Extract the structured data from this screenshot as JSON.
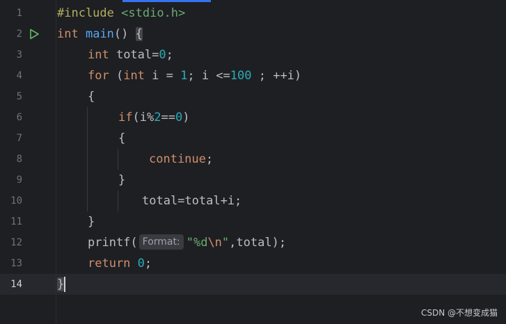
{
  "editor": {
    "line_numbers": [
      "1",
      "2",
      "3",
      "4",
      "5",
      "6",
      "7",
      "8",
      "9",
      "10",
      "11",
      "12",
      "13",
      "14"
    ],
    "current_line": "14",
    "lines": {
      "l1": {
        "inc": "#include",
        "sp": " ",
        "header": "<stdio.h>"
      },
      "l2": {
        "type": "int",
        "name": "main",
        "parens": "() ",
        "brace": "{"
      },
      "l3": {
        "type": "int",
        "rest": " total=",
        "value": "0",
        "end": ";"
      },
      "l4": {
        "kw": "for",
        "p1": " (",
        "type": "int",
        "p2": " i = ",
        "n1": "1",
        "p3": "; i <=",
        "n2": "100",
        "p4": " ; ++i)"
      },
      "l5": {
        "text": "{"
      },
      "l6": {
        "kw": "if",
        "p1": "(i%",
        "n1": "2",
        "p2": "==",
        "n2": "0",
        "p3": ")"
      },
      "l7": {
        "text": "{"
      },
      "l8": {
        "kw": "continue",
        "end": ";"
      },
      "l9": {
        "text": "}"
      },
      "l10": {
        "text": "total=total+i;"
      },
      "l11": {
        "text": "}"
      },
      "l12": {
        "fn": "printf(",
        "hint": "Format:",
        "q1": "\"%d",
        "esc": "\\n",
        "q2": "\"",
        "rest": ",total);"
      },
      "l13": {
        "kw": "return",
        "sp": " ",
        "value": "0",
        "end": ";"
      },
      "l14": {
        "text": "}"
      }
    }
  },
  "watermark": "CSDN @不想变成猫",
  "colors": {
    "background": "#1e1f22",
    "keyword": "#cf8e6d",
    "function": "#56a8f5",
    "number": "#2aacb8",
    "string": "#6aab73",
    "run_icon": "#5fb865"
  }
}
